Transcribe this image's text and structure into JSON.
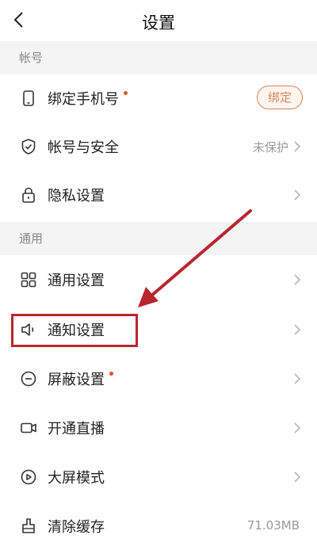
{
  "header": {
    "title": "设置"
  },
  "sections": {
    "account": {
      "title": "帐号"
    },
    "general": {
      "title": "通用"
    }
  },
  "rows": {
    "bind_phone": {
      "label": "绑定手机号",
      "button": "绑定",
      "has_dot": true
    },
    "account_security": {
      "label": "帐号与安全",
      "value": "未保护"
    },
    "privacy": {
      "label": "隐私设置"
    },
    "general_settings": {
      "label": "通用设置"
    },
    "notification": {
      "label": "通知设置",
      "highlighted": true
    },
    "block": {
      "label": "屏蔽设置",
      "has_dot": true
    },
    "live": {
      "label": "开通直播"
    },
    "big_screen": {
      "label": "大屏模式"
    },
    "cache": {
      "label": "清除缓存",
      "value": "71.03MB"
    }
  },
  "colors": {
    "accent": "#d4855a",
    "dot": "#e0522c",
    "annotation": "#b8262d",
    "section_bg": "#f4f4f4"
  },
  "icons": {
    "back": "chevron-left-icon",
    "bind_phone": "phone-icon",
    "account_security": "shield-check-icon",
    "privacy": "lock-icon",
    "general_settings": "grid-icon",
    "notification": "speaker-icon",
    "block": "minus-circle-icon",
    "live": "video-camera-icon",
    "big_screen": "play-screen-icon",
    "cache": "broom-icon"
  }
}
